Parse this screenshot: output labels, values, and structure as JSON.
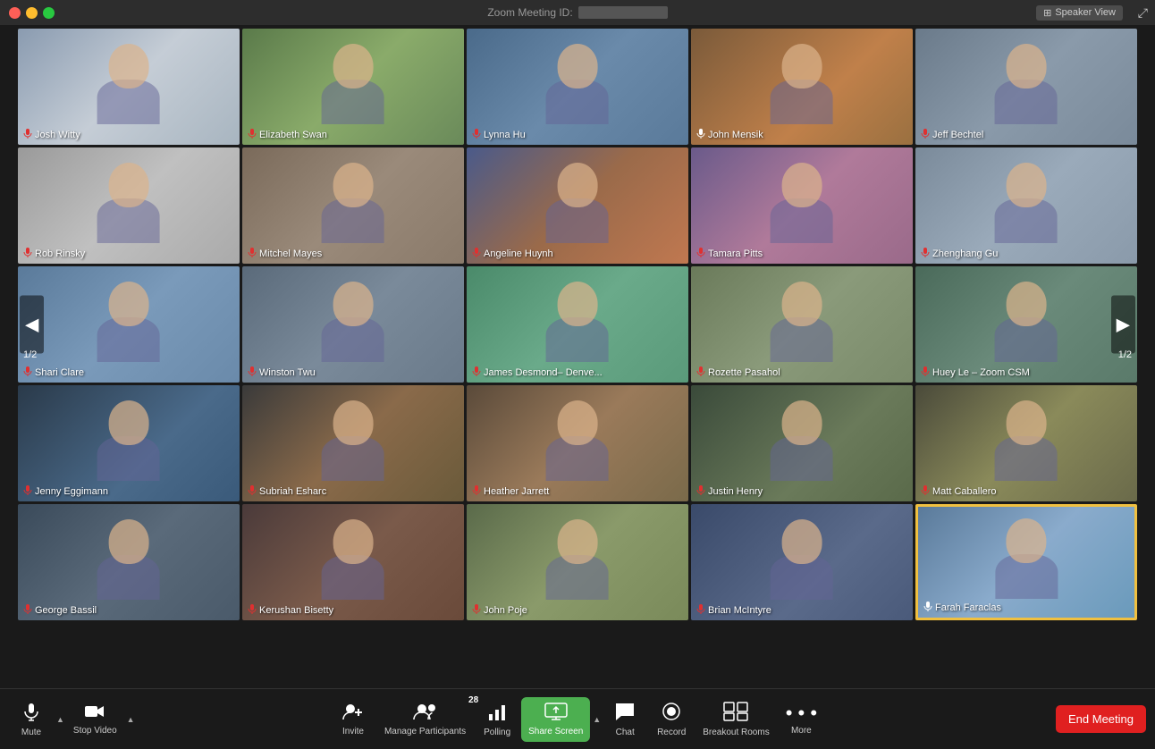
{
  "titlebar": {
    "meeting_id_label": "Zoom Meeting ID:",
    "speaker_view_label": "Speaker View"
  },
  "participants": [
    {
      "name": "Josh Witty",
      "muted": true
    },
    {
      "name": "Elizabeth Swan",
      "muted": true
    },
    {
      "name": "Lynna Hu",
      "muted": true
    },
    {
      "name": "John Mensik",
      "muted": false
    },
    {
      "name": "Jeff Bechtel",
      "muted": true
    },
    {
      "name": "Rob Rinsky",
      "muted": true
    },
    {
      "name": "Mitchel Mayes",
      "muted": true
    },
    {
      "name": "Angeline Huynh",
      "muted": true
    },
    {
      "name": "Tamara Pitts",
      "muted": true
    },
    {
      "name": "Zhenghang Gu",
      "muted": true
    },
    {
      "name": "Shari Clare",
      "muted": true
    },
    {
      "name": "Winston Twu",
      "muted": true
    },
    {
      "name": "James Desmond– Denve...",
      "muted": true
    },
    {
      "name": "Rozette Pasahol",
      "muted": true
    },
    {
      "name": "Huey Le – Zoom CSM",
      "muted": true
    },
    {
      "name": "Jenny Eggimann",
      "muted": true
    },
    {
      "name": "Subriah Esharc",
      "muted": true
    },
    {
      "name": "Heather Jarrett",
      "muted": true
    },
    {
      "name": "Justin Henry",
      "muted": true
    },
    {
      "name": "Matt Caballero",
      "muted": true
    },
    {
      "name": "George Bassil",
      "muted": true
    },
    {
      "name": "Kerushan Bisetty",
      "muted": true
    },
    {
      "name": "John Poje",
      "muted": true
    },
    {
      "name": "Brian McIntyre",
      "muted": true
    },
    {
      "name": "Farah Faraclas",
      "muted": false,
      "highlighted": true
    }
  ],
  "nav": {
    "left_page": "1/2",
    "right_page": "1/2"
  },
  "toolbar": {
    "mute_label": "Mute",
    "stop_video_label": "Stop Video",
    "invite_label": "Invite",
    "manage_participants_label": "Manage Participants",
    "participants_count": "28",
    "polling_label": "Polling",
    "share_screen_label": "Share Screen",
    "chat_label": "Chat",
    "record_label": "Record",
    "breakout_rooms_label": "Breakout Rooms",
    "more_label": "More",
    "end_meeting_label": "End Meeting"
  }
}
